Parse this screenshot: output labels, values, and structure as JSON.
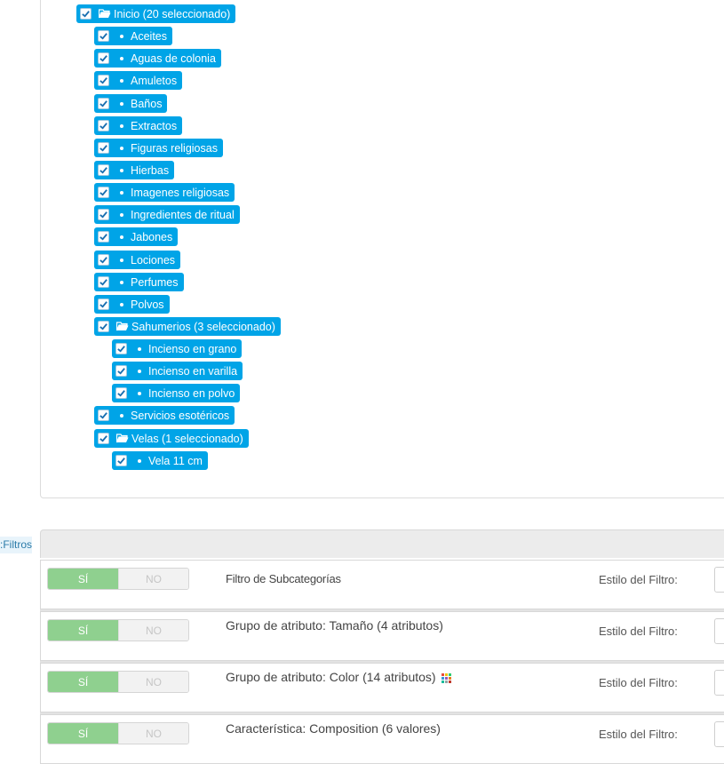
{
  "tree": {
    "root": {
      "label": "Inicio (20 seleccionado)"
    },
    "items": [
      {
        "label": "Aceites"
      },
      {
        "label": "Aguas de colonia"
      },
      {
        "label": "Amuletos"
      },
      {
        "label": "Baños"
      },
      {
        "label": "Extractos"
      },
      {
        "label": "Figuras religiosas"
      },
      {
        "label": "Hierbas"
      },
      {
        "label": "Imagenes religiosas"
      },
      {
        "label": "Ingredientes de ritual"
      },
      {
        "label": "Jabones"
      },
      {
        "label": "Lociones"
      },
      {
        "label": "Perfumes"
      },
      {
        "label": "Polvos"
      },
      {
        "label": "Sahumerios (3 seleccionado)"
      },
      {
        "label": "Incienso en grano"
      },
      {
        "label": "Incienso en varilla"
      },
      {
        "label": "Incienso en polvo"
      },
      {
        "label": "Servicios esotéricos"
      },
      {
        "label": "Velas (1 seleccionado)"
      },
      {
        "label": "Vela 11 cm"
      }
    ],
    "checked": true,
    "colors": {
      "item_bg": "#00a4e7",
      "item_text": "#ffffff"
    }
  },
  "filters": {
    "section_label": "Filtros:",
    "switch": {
      "on_label": "SÍ",
      "off_label": "NO"
    },
    "style_label": "Estilo del Filtro:",
    "rows": [
      {
        "name": "Filtro de Subcategorías",
        "enabled": true
      },
      {
        "name": "Grupo de atributo: Tamaño (4 atributos)",
        "enabled": true
      },
      {
        "name": "Grupo de atributo: Color (14 atributos)",
        "enabled": true,
        "icon": "color-palette-icon"
      },
      {
        "name": "Característica: Composition (6 valores)",
        "enabled": true
      }
    ],
    "colors": {
      "switch_on": "#8fd08f",
      "switch_off": "#f2f2f2"
    }
  }
}
